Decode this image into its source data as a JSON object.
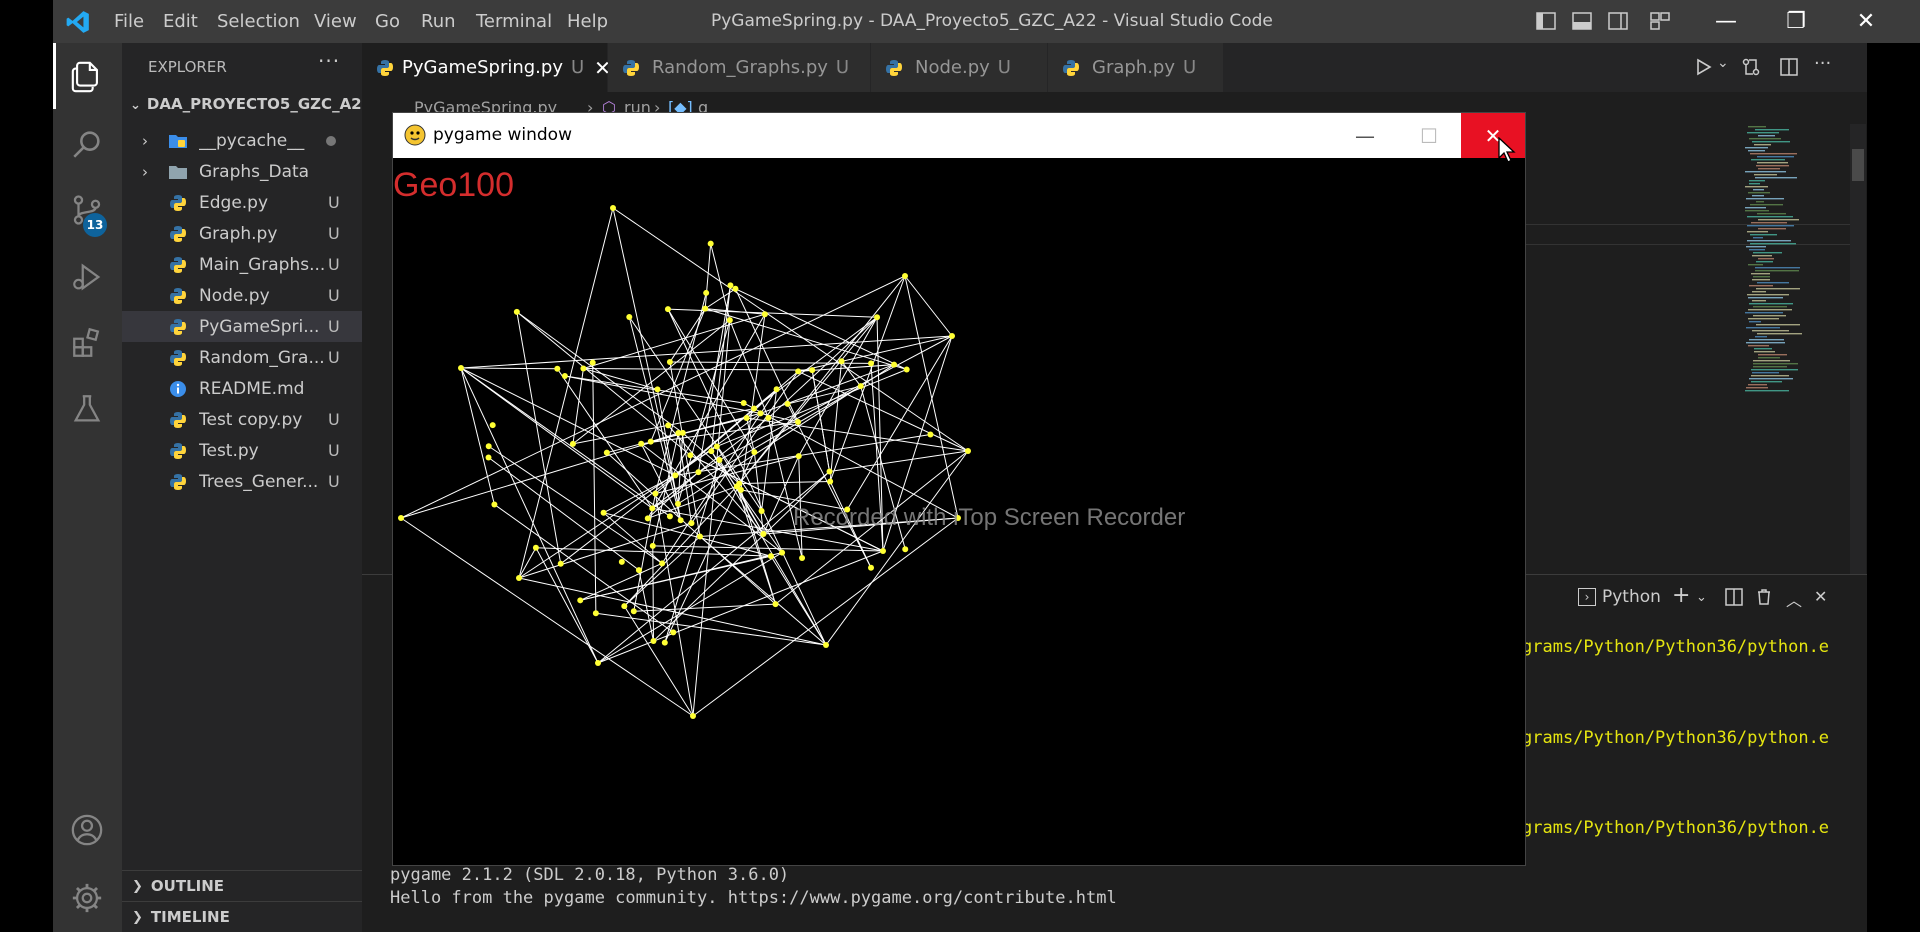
{
  "titlebar": {
    "menus": [
      "File",
      "Edit",
      "Selection",
      "View",
      "Go",
      "Run",
      "Terminal",
      "Help"
    ],
    "title": "PyGameSpring.py - DAA_Proyecto5_GZC_A22 - Visual Studio Code"
  },
  "activity": {
    "scm_badge": "13"
  },
  "sidebar": {
    "title": "EXPLORER",
    "more": "···",
    "folder": "DAA_PROYECTO5_GZC_A22",
    "items": [
      {
        "name": "__pycache__",
        "type": "folder",
        "status": ""
      },
      {
        "name": "Graphs_Data",
        "type": "folder",
        "status": ""
      },
      {
        "name": "Edge.py",
        "type": "python",
        "status": "U"
      },
      {
        "name": "Graph.py",
        "type": "python",
        "status": "U"
      },
      {
        "name": "Main_Graphs...",
        "type": "python",
        "status": "U"
      },
      {
        "name": "Node.py",
        "type": "python",
        "status": "U"
      },
      {
        "name": "PyGameSpri...",
        "type": "python",
        "status": "U"
      },
      {
        "name": "Random_Gra...",
        "type": "python",
        "status": "U"
      },
      {
        "name": "README.md",
        "type": "info",
        "status": ""
      },
      {
        "name": "Test copy.py",
        "type": "python",
        "status": "U"
      },
      {
        "name": "Test.py",
        "type": "python",
        "status": "U"
      },
      {
        "name": "Trees_Gener...",
        "type": "python",
        "status": "U"
      }
    ],
    "outline": "OUTLINE",
    "timeline": "TIMELINE"
  },
  "tabs": [
    {
      "label": "PyGameSpring.py",
      "status": "U",
      "close": "✕"
    },
    {
      "label": "Random_Graphs.py",
      "status": "U"
    },
    {
      "label": "Node.py",
      "status": "U"
    },
    {
      "label": "Graph.py",
      "status": "U"
    }
  ],
  "breadcrumb": {
    "file": "PyGameSpring.py",
    "fn": "run",
    "var": "g"
  },
  "panel": {
    "shell": "Python",
    "path_lines": [
      "grams/Python/Python36/python.e",
      "grams/Python/Python36/python.e",
      "grams/Python/Python36/python.e"
    ],
    "line1": "pygame 2.1.2 (SDL 2.0.18, Python 3.6.0)",
    "line2": "Hello from the pygame community. https://www.pygame.org/contribute.html"
  },
  "pygame": {
    "title": "pygame window",
    "label": "Geo100",
    "watermark": "Recorded with iTop Screen Recorder"
  },
  "colors": {
    "titlebar": "#3c3c3c",
    "activity": "#333333",
    "sidebar": "#252526",
    "editor": "#1e1e1e",
    "accent": "#0e639c",
    "python_blue": "#3572A5",
    "python_yellow": "#FFD43B",
    "node": "#ffff33",
    "edge": "#ffffff",
    "close_red": "#e81123",
    "label_red": "#d42d2d"
  }
}
